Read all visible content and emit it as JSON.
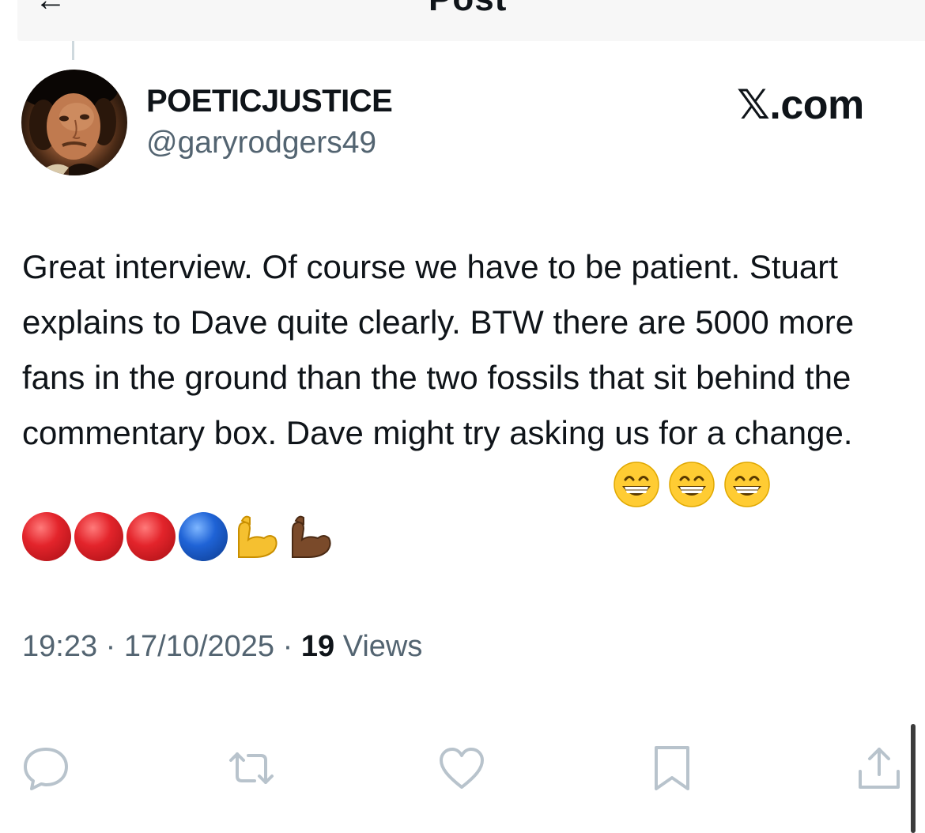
{
  "header": {
    "back_icon": "back-arrow-icon",
    "title": "Post"
  },
  "post": {
    "author": {
      "display_name": "POETICJUSTICE",
      "handle": "@garyrodgers49",
      "avatar_icon": "portrait-avatar"
    },
    "watermark": "𝕏.com",
    "text": "Great interview. Of course we have to be patient. Stuart explains to Dave quite clearly. BTW there are 5000 more fans in the ground than the two fossils that sit behind the commentary box. Dave might try asking us for a change.",
    "inline_emojis": [
      "grinning-face-with-smiling-eyes",
      "grinning-face-with-smiling-eyes",
      "grinning-face-with-smiling-eyes"
    ],
    "emoji_row": [
      "red-circle",
      "red-circle",
      "red-circle",
      "blue-circle",
      "flexed-biceps-light",
      "flexed-biceps-dark"
    ],
    "time": "19:23",
    "separator": "·",
    "date": "17/10/2025",
    "views_count": "19",
    "views_label": "Views"
  },
  "actions": [
    {
      "name": "reply",
      "icon": "reply-icon"
    },
    {
      "name": "repost",
      "icon": "repost-icon"
    },
    {
      "name": "like",
      "icon": "heart-icon"
    },
    {
      "name": "bookmark",
      "icon": "bookmark-icon"
    },
    {
      "name": "share",
      "icon": "share-icon"
    }
  ],
  "colors": {
    "text_primary": "#0f1419",
    "text_secondary": "#536471",
    "icon_gray": "#b8c3cc"
  }
}
